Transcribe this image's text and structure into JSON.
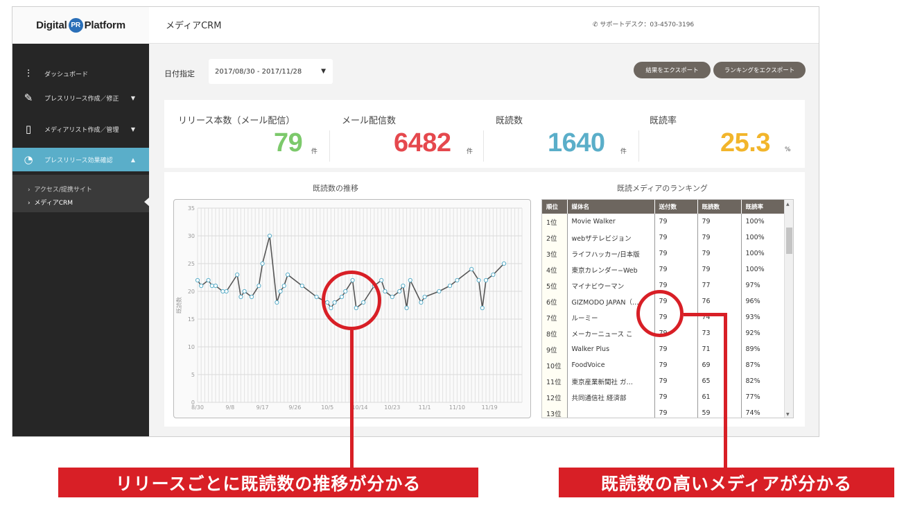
{
  "app": {
    "logo_left": "Digital",
    "logo_mark": "PR",
    "logo_right": "Platform",
    "page_title": "メディアCRM",
    "support": "サポートデスク：03-4570-3196"
  },
  "sidebar": {
    "items": [
      {
        "label": "ダッシュボード",
        "icon": "sliders-icon"
      },
      {
        "label": "プレスリリース作成／修正",
        "icon": "edit-icon",
        "caret": "▼"
      },
      {
        "label": "メディアリスト作成／管理",
        "icon": "notebook-icon",
        "caret": "▼"
      },
      {
        "label": "プレスリリース効果確認",
        "icon": "pie-chart-icon",
        "caret": "▲"
      }
    ],
    "sub_items": [
      {
        "label": "アクセス/提携サイト"
      },
      {
        "label": "メディアCRM"
      }
    ]
  },
  "filters": {
    "date_label": "日付指定",
    "date_range": "2017/08/30 - 2017/11/28",
    "export_results": "結果をエクスポート",
    "export_ranking": "ランキングをエクスポート"
  },
  "stats": [
    {
      "label": "リリース本数（メール配信）",
      "value": "79",
      "unit": "件",
      "color": "#7cc96b"
    },
    {
      "label": "メール配信数",
      "value": "6482",
      "unit": "件",
      "color": "#e5484d"
    },
    {
      "label": "既読数",
      "value": "1640",
      "unit": "件",
      "color": "#5aaec9"
    },
    {
      "label": "既読率",
      "value": "25.3",
      "unit": "%",
      "color": "#f2b52b"
    }
  ],
  "chart_title": "既読数の推移",
  "chart_data": {
    "type": "line",
    "ylabel": "既読数",
    "ylim": [
      0,
      35
    ],
    "yticks": [
      0,
      5,
      10,
      15,
      20,
      25,
      30,
      35
    ],
    "xticks": [
      "8/30",
      "9/8",
      "9/17",
      "9/26",
      "10/5",
      "10/14",
      "10/23",
      "11/1",
      "11/10",
      "11/19"
    ],
    "x": [
      "8/30",
      "8/31",
      "9/2",
      "9/3",
      "9/4",
      "9/6",
      "9/7",
      "9/10",
      "9/11",
      "9/12",
      "9/14",
      "9/16",
      "9/17",
      "9/19",
      "9/21",
      "9/22",
      "9/23",
      "9/24",
      "9/28",
      "10/2",
      "10/5",
      "10/6",
      "10/7",
      "10/9",
      "10/10",
      "10/12",
      "10/13",
      "10/15",
      "10/18",
      "10/20",
      "10/21",
      "10/23",
      "10/25",
      "10/26",
      "10/27",
      "10/28",
      "10/31",
      "11/1",
      "11/5",
      "11/8",
      "11/10",
      "11/14",
      "11/16",
      "11/17",
      "11/18",
      "11/20",
      "11/23"
    ],
    "series": [
      {
        "values": [
          22,
          21,
          22,
          21,
          21,
          20,
          20,
          23,
          19,
          20,
          19,
          21,
          25,
          30,
          18,
          20,
          21,
          23,
          21,
          19,
          18,
          17,
          18,
          19,
          20,
          22,
          17,
          18,
          21,
          22,
          20,
          19,
          20,
          21,
          17,
          22,
          18,
          19,
          20,
          21,
          22,
          24,
          22,
          17,
          22,
          23,
          25
        ]
      }
    ]
  },
  "ranking": {
    "title": "既読メディアのランキング",
    "headers": [
      "順位",
      "媒体名",
      "送付数",
      "既読数",
      "既読率"
    ],
    "rows": [
      [
        "1位",
        "Movie Walker",
        "79",
        "79",
        "100%"
      ],
      [
        "2位",
        "webザテレビジョン",
        "79",
        "79",
        "100%"
      ],
      [
        "3位",
        "ライフハッカー/日本版",
        "79",
        "79",
        "100%"
      ],
      [
        "4位",
        "東京カレンダー−Web",
        "79",
        "79",
        "100%"
      ],
      [
        "5位",
        "マイナビウーマン",
        "79",
        "77",
        "97%"
      ],
      [
        "6位",
        "GIZMODO JAPAN（…",
        "79",
        "76",
        "96%"
      ],
      [
        "7位",
        "ルーミー",
        "79",
        "74",
        "93%"
      ],
      [
        "8位",
        "メーカーニュース こ",
        "79",
        "73",
        "92%"
      ],
      [
        "9位",
        "Walker Plus",
        "79",
        "71",
        "89%"
      ],
      [
        "10位",
        "FoodVoice",
        "79",
        "69",
        "87%"
      ],
      [
        "11位",
        "東京産業新聞社 ガ…",
        "79",
        "65",
        "82%"
      ],
      [
        "12位",
        "共同通信社 経済部",
        "79",
        "61",
        "77%"
      ],
      [
        "13位",
        "",
        "79",
        "59",
        "74%"
      ]
    ]
  },
  "callouts": {
    "left": "リリースごとに既読数の推移が分かる",
    "right": "既読数の高いメディアが分かる"
  }
}
